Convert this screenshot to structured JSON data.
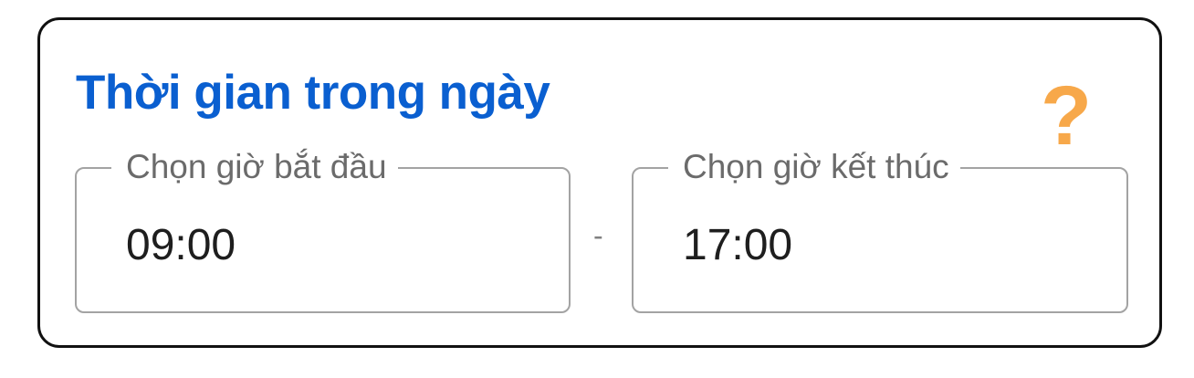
{
  "title": "Thời gian trong ngày",
  "help_icon": {
    "glyph": "?",
    "name": "help-icon",
    "color": "#f7a84a"
  },
  "start_field": {
    "label": "Chọn giờ bắt đầu",
    "value": "09:00"
  },
  "separator": "-",
  "end_field": {
    "label": "Chọn giờ kết thúc",
    "value": "17:00"
  },
  "colors": {
    "title": "#0a5fd0",
    "border": "#111111",
    "field_border": "#a3a3a3"
  }
}
